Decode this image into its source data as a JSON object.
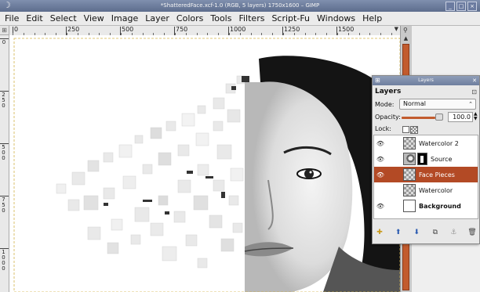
{
  "window": {
    "title": "*ShatteredFace.xcf-1.0 (RGB, 5 layers) 1750x1600 – GIMP",
    "buttons": [
      "_",
      "□",
      "×"
    ]
  },
  "menubar": [
    "File",
    "Edit",
    "Select",
    "View",
    "Image",
    "Layer",
    "Colors",
    "Tools",
    "Filters",
    "Script-Fu",
    "Windows",
    "Help"
  ],
  "hruler": {
    "labels": [
      "0",
      "250",
      "500",
      "750",
      "1000",
      "1250",
      "1500"
    ]
  },
  "vruler": {
    "labels": [
      "0",
      "250",
      "500",
      "750",
      "1000"
    ]
  },
  "layers_dock": {
    "title": "Layers",
    "header": "Layers",
    "mode_label": "Mode:",
    "mode_value": "Normal",
    "opacity_label": "Opacity:",
    "opacity_value": "100.0",
    "opacity_fraction": 1.0,
    "lock_label": "Lock:",
    "layers": [
      {
        "name": "Watercolor 2",
        "visible": true,
        "selected": false,
        "bold": false
      },
      {
        "name": "Source",
        "visible": true,
        "selected": false,
        "bold": false
      },
      {
        "name": "Face Pieces",
        "visible": true,
        "selected": true,
        "bold": false
      },
      {
        "name": "Watercolor",
        "visible": false,
        "selected": false,
        "bold": false
      },
      {
        "name": "Background",
        "visible": true,
        "selected": false,
        "bold": true
      }
    ],
    "toolbar_icons": [
      "new-layer-icon",
      "raise-layer-icon",
      "lower-layer-icon",
      "duplicate-layer-icon",
      "anchor-layer-icon",
      "delete-layer-icon"
    ]
  },
  "colors": {
    "accent": "#b34a25",
    "scrollbar": "#c25b2e",
    "titlebar": "#6f7f9f"
  }
}
